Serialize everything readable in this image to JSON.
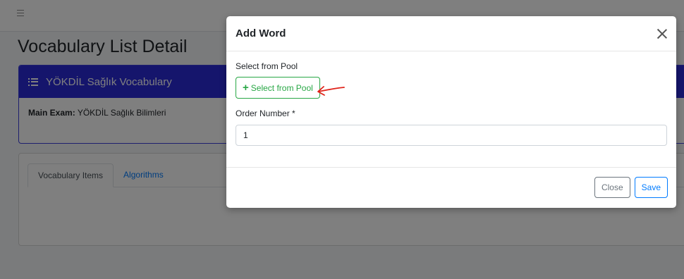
{
  "page": {
    "title": "Vocabulary List Detail"
  },
  "list_card": {
    "title": "YÖKDİL Sağlık Vocabulary",
    "main_exam_label": "Main Exam:",
    "main_exam_value": "YÖKDİL Sağlık Bilimleri"
  },
  "tabs": [
    {
      "label": "Vocabulary Items",
      "active": true
    },
    {
      "label": "Algorithms",
      "active": false
    }
  ],
  "modal": {
    "title": "Add Word",
    "pool_label": "Select from Pool",
    "pool_button": "Select from Pool",
    "order_label": "Order Number *",
    "order_value": "1",
    "close_button": "Close",
    "save_button": "Save"
  },
  "colors": {
    "card_header": "#2a2ad8",
    "success": "#28a745",
    "primary": "#007bff",
    "annotation_arrow": "#e0241b"
  }
}
